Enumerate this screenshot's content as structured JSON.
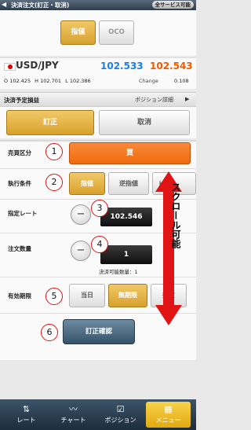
{
  "header": {
    "title": "決済注文(訂正・取消)",
    "all_services": "全サービス可能"
  },
  "order_type_tabs": {
    "limit": "指値",
    "oco": "OCO"
  },
  "pair": {
    "name": "USD/JPY",
    "bid": "102.533",
    "ask": "102.543",
    "open_label": "O",
    "open": "102.425",
    "high_label": "H",
    "high": "102.701",
    "low_label": "L",
    "low": "102.386",
    "change_label": "Change",
    "change": "0.108"
  },
  "pl_row": {
    "label": "決済予定損益",
    "detail_link": "ポジション詳細"
  },
  "actions": {
    "modify": "訂正",
    "cancel": "取消"
  },
  "form": {
    "side_label": "売買区分",
    "side_value": "買",
    "condition_label": "執行条件",
    "cond_limit": "指値",
    "cond_stop": "逆指値",
    "cond_trail": "トレ",
    "rate_label": "指定レート",
    "rate_value": "102.546",
    "qty_label": "注文数量",
    "qty_value": "1",
    "settle_qty_label": "決済可能数量：",
    "settle_qty": "1",
    "expiry_label": "有効期限",
    "exp_day": "当日",
    "exp_none": "無期限",
    "exp_spec": "指定",
    "confirm": "訂正確認"
  },
  "annotations": {
    "n1": "1",
    "n2": "2",
    "n3": "3",
    "n4": "4",
    "n5": "5",
    "n6": "6",
    "scroll_text": "スクロール可能"
  },
  "tabbar": {
    "rate": "レート",
    "chart": "チャート",
    "position": "ポジション",
    "menu": "メニュー"
  },
  "colors": {
    "bid": "#1a7fe0",
    "ask": "#f05a00",
    "side": "#f26a0c",
    "accent": "#e0a52a",
    "annotation": "#d11111"
  }
}
